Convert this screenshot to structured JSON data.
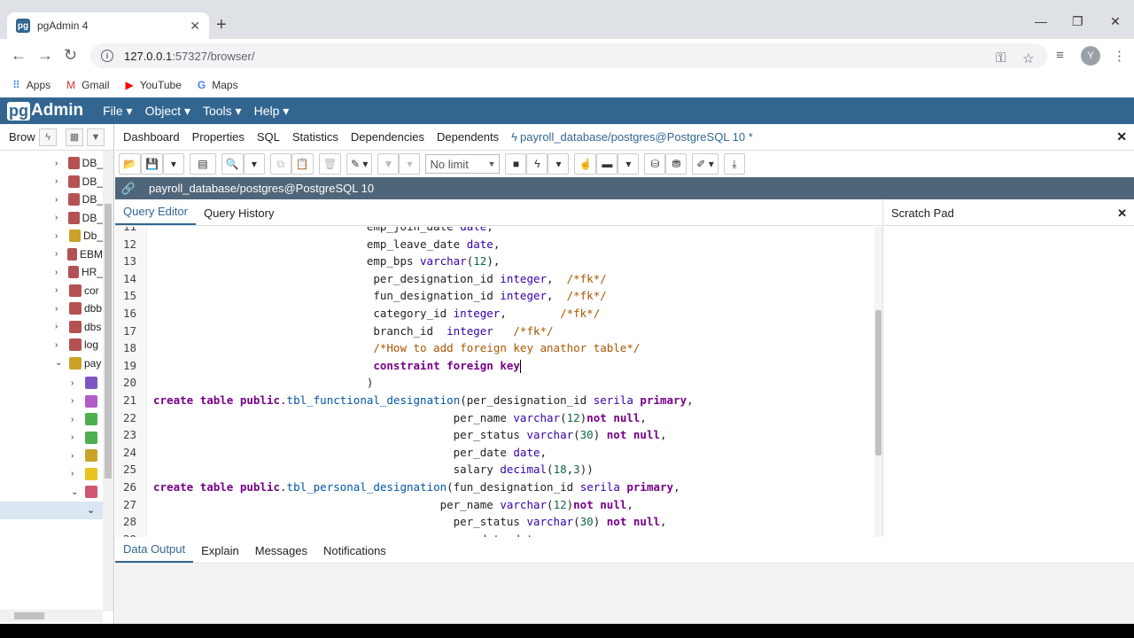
{
  "browser": {
    "tab_title": "pgAdmin 4",
    "tab_favicon": "pg",
    "url_host": "127.0.0.1",
    "url_path": ":57327/browser/",
    "bookmarks": [
      {
        "label": "Apps",
        "icon": "apps-grid-icon"
      },
      {
        "label": "Gmail",
        "icon": "gmail-icon"
      },
      {
        "label": "YouTube",
        "icon": "youtube-icon"
      },
      {
        "label": "Maps",
        "icon": "google-icon"
      }
    ],
    "avatar_initial": "Y"
  },
  "pgadmin": {
    "logo_pg": "pg",
    "logo_rest": "Admin",
    "menus": [
      "File",
      "Object",
      "Tools",
      "Help"
    ],
    "brand_color": "#326690"
  },
  "browser_panel": {
    "title": "Brow",
    "tree": [
      {
        "label": "DB_",
        "icon_color": "#b45252"
      },
      {
        "label": "DB_",
        "icon_color": "#b45252"
      },
      {
        "label": "DB_",
        "icon_color": "#b45252"
      },
      {
        "label": "DB_",
        "icon_color": "#b45252"
      },
      {
        "label": "Db_",
        "icon_color": "#c9a227"
      },
      {
        "label": "EBM",
        "icon_color": "#b45252"
      },
      {
        "label": "HR_",
        "icon_color": "#b45252"
      },
      {
        "label": "cor",
        "icon_color": "#b45252"
      },
      {
        "label": "dbb",
        "icon_color": "#b45252"
      },
      {
        "label": "dbs",
        "icon_color": "#b45252"
      },
      {
        "label": "log",
        "icon_color": "#b45252"
      },
      {
        "label": "pay",
        "icon_color": "#c9a227"
      }
    ]
  },
  "main_tabs": [
    "Dashboard",
    "Properties",
    "SQL",
    "Statistics",
    "Dependencies",
    "Dependents"
  ],
  "active_tab": "payroll_database/postgres@PostgreSQL 10 *",
  "toolbar": {
    "limit": "No limit"
  },
  "connection": "payroll_database/postgres@PostgreSQL 10",
  "editor_tabs": [
    "Query Editor",
    "Query History"
  ],
  "scratch_pad": "Scratch Pad",
  "output_tabs": [
    "Data Output",
    "Explain",
    "Messages",
    "Notifications"
  ],
  "code_lines": [
    {
      "n": "11",
      "t": "                                emp_join_date date,"
    },
    {
      "n": "12",
      "t": "                                emp_leave_date date,"
    },
    {
      "n": "13",
      "t": "                                emp_bps varchar(12),"
    },
    {
      "n": "14",
      "t": "                                 per_designation_id integer,  /*fk*/"
    },
    {
      "n": "15",
      "t": "                                 fun_designation_id integer,  /*fk*/"
    },
    {
      "n": "16",
      "t": "                                 category_id integer,        /*fk*/"
    },
    {
      "n": "17",
      "t": "                                 branch_id  integer   /*fk*/"
    },
    {
      "n": "18",
      "t": "                                 /*How to add foreign key anathor table*/"
    },
    {
      "n": "19",
      "t": "                                 constraint foreign key"
    },
    {
      "n": "20",
      "t": "                                )"
    },
    {
      "n": "21",
      "t": "create table public.tbl_functional_designation(per_designation_id serila primary,"
    },
    {
      "n": "22",
      "t": "                                             per_name varchar(12)not null,"
    },
    {
      "n": "23",
      "t": "                                             per_status varchar(30) not null,"
    },
    {
      "n": "24",
      "t": "                                             per_date date,"
    },
    {
      "n": "25",
      "t": "                                             salary decimal(18,3))"
    },
    {
      "n": "26",
      "t": "create table public.tbl_personal_designation(fun_designation_id serila primary,"
    },
    {
      "n": "27",
      "t": "                                           per_name varchar(12)not null,"
    },
    {
      "n": "28",
      "t": "                                             per_status varchar(30) not null,"
    },
    {
      "n": "29",
      "t": "                                             per_date date,"
    }
  ]
}
